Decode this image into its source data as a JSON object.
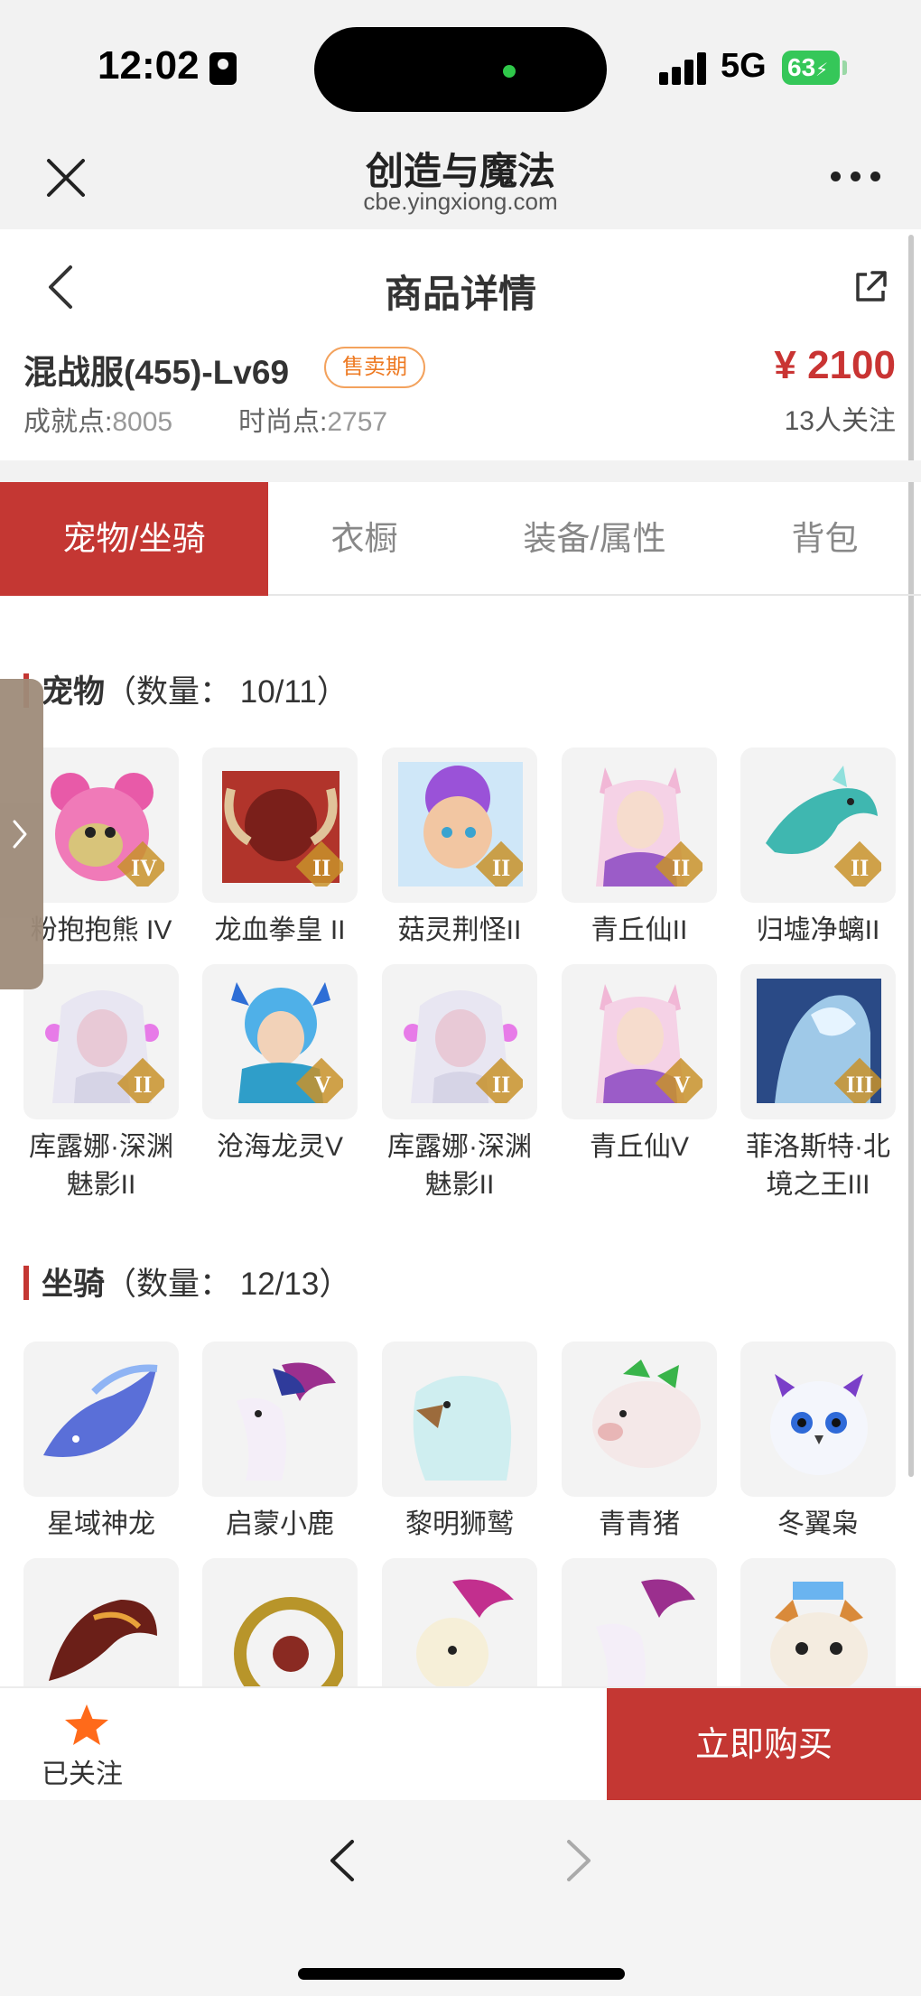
{
  "status": {
    "time": "12:02",
    "network": "5G",
    "battery": "63"
  },
  "browser": {
    "title": "创造与魔法",
    "url": "cbe.yingxiong.com"
  },
  "nav": {
    "title": "商品详情"
  },
  "product": {
    "name": "混战服(455)-Lv69",
    "badge": "售卖期",
    "price": "¥ 2100",
    "followers": "13人关注",
    "achievement_label": "成就点:",
    "achievement_value": "8005",
    "fashion_label": "时尚点:",
    "fashion_value": "2757"
  },
  "tabs": [
    "宠物/坐骑",
    "衣橱",
    "装备/属性",
    "背包"
  ],
  "pets": {
    "title": "宠物",
    "count": "（数量： 10/11）",
    "items": [
      "粉抱抱熊 IV",
      "龙血拳皇 II",
      "菇灵荆怪II",
      "青丘仙II",
      "归墟净螭II",
      "库露娜·深渊魅影II",
      "沧海龙灵V",
      "库露娜·深渊魅影II",
      "青丘仙V",
      "菲洛斯特·北境之王III"
    ]
  },
  "mounts": {
    "title": "坐骑",
    "count": "（数量： 12/13）",
    "items": [
      "星域神龙",
      "启蒙小鹿",
      "黎明狮鹫",
      "青青猪",
      "冬翼枭"
    ]
  },
  "actions": {
    "follow": "已关注",
    "buy": "立即购买"
  },
  "colors": {
    "accent": "#c43733",
    "badge": "#ee7b24",
    "star": "#ff6a1a"
  }
}
